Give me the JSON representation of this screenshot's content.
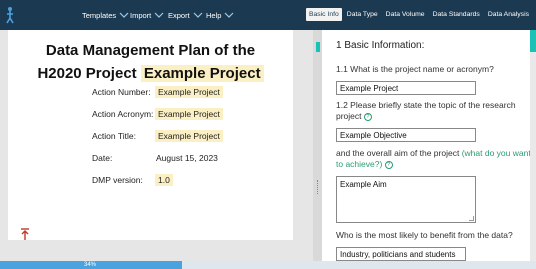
{
  "menu": {
    "templates": "Templates",
    "import": "Import",
    "export": "Export",
    "help": "Help"
  },
  "tabs": [
    "Basic Info",
    "Data Type",
    "Data Volume",
    "Data Standards",
    "Data Analysis"
  ],
  "active_tab": "Basic Info",
  "document": {
    "title_line1": "Data Management Plan of the",
    "title_line2_prefix": "H2020 Project",
    "title_line2_highlight": "Example Project",
    "rows": [
      {
        "label": "Action Number:",
        "value": "Example Project",
        "highlight": true
      },
      {
        "label": "Action Acronym:",
        "value": "Example Project",
        "highlight": true
      },
      {
        "label": "Action Title:",
        "value": "Example Project",
        "highlight": true
      },
      {
        "label": "Date:",
        "value": "August 15, 2023",
        "highlight": false
      },
      {
        "label": "DMP version:",
        "value": "1.0",
        "highlight": true
      }
    ]
  },
  "form": {
    "section_title": "1 Basic Information:",
    "q1": "1.1 What is the project name or acronym?",
    "q1_value": "Example Project",
    "q2": "1.2 Please briefly state the topic of the research project",
    "q2_value": "Example Objective",
    "q3_prefix": "and the overall aim of the project",
    "q3_link": "(what do you want to achieve?)",
    "q3_value": "Example Aim",
    "q4": "Who is the most likely to benefit from the data?",
    "q4_value": "Industry, politicians and students"
  },
  "progress": {
    "value": 0.34,
    "label": "34%"
  },
  "colors": {
    "topbar": "#1b3a52",
    "accent": "#19c2b4",
    "highlight": "#fbefc4",
    "progress": "#4aa3df",
    "help_link": "#2a9d6e"
  }
}
